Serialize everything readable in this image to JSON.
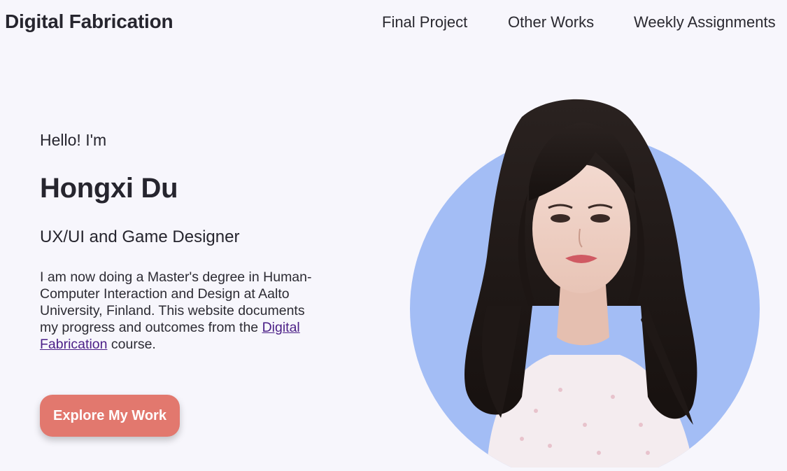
{
  "header": {
    "brand": "Digital Fabrication",
    "nav": [
      {
        "label": "Final Project"
      },
      {
        "label": "Other Works"
      },
      {
        "label": "Weekly Assignments"
      }
    ]
  },
  "hero": {
    "greeting": "Hello! I'm",
    "name": "Hongxi Du",
    "role": "UX/UI and Game Designer",
    "bio_before": "I am now doing a Master's degree in Human-Computer Interaction and Design at Aalto University, Finland. This website documents my progress and outcomes from the ",
    "bio_link": "Digital Fabrication",
    "bio_after": " course.",
    "cta_label": "Explore My Work"
  },
  "colors": {
    "background": "#f7f6fc",
    "accent_button": "#e2786e",
    "circle": "#a3bdf5",
    "link": "#4b1f87"
  }
}
